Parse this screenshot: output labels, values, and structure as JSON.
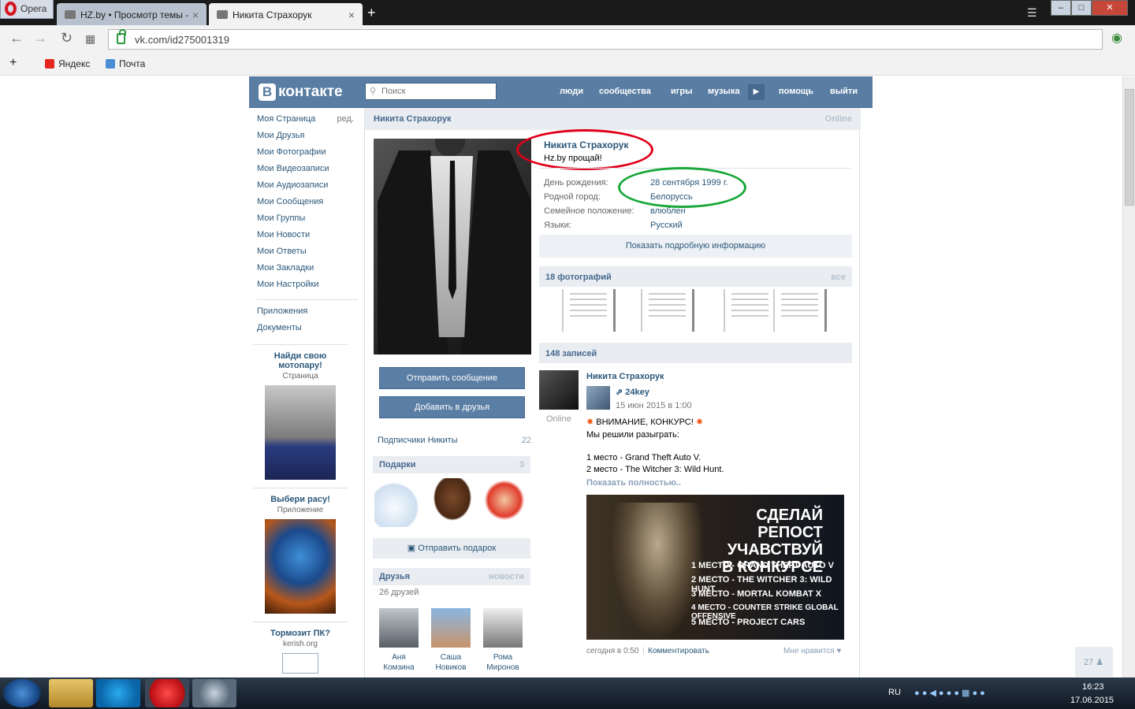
{
  "browser": {
    "opera_label": "Opera",
    "tab1_title": "HZ.by • Просмотр темы -",
    "tab2_title": "Никита Страхорук",
    "url": "vk.com/id275001319",
    "bookmarks": [
      "Яндекс",
      "Почта"
    ]
  },
  "vk": {
    "logo": "контакте",
    "logo_letter": "В",
    "search_placeholder": "Поиск",
    "topnav": [
      "люди",
      "сообщества",
      "игры",
      "музыка",
      "помощь",
      "выйти"
    ],
    "left_menu": [
      "Моя Страница",
      "Мои Друзья",
      "Мои Фотографии",
      "Мои Видеозаписи",
      "Мои Аудиозаписи",
      "Мои Сообщения",
      "Мои Группы",
      "Мои Новости",
      "Мои Ответы",
      "Мои Закладки",
      "Мои Настройки"
    ],
    "edit_label": "ред.",
    "extra_menu": [
      "Приложения",
      "Документы"
    ],
    "ads": [
      {
        "title": "Найди свою мотопару!",
        "sub": "Страница"
      },
      {
        "title": "Выбери расу!",
        "sub": "Приложение"
      },
      {
        "title": "Тормозит ПК?",
        "sub": "kerish.org"
      }
    ],
    "header_name": "Никита Страхорук",
    "online_label": "Online",
    "profile_name": "Никита Страхорук",
    "status": "Hz.by прощай!",
    "info": [
      {
        "label": "День рождения:",
        "value": "28 сентября 1999 г."
      },
      {
        "label": "Родной город:",
        "value": "Белоруссь"
      },
      {
        "label": "Семейное положение:",
        "value": "влюблен"
      },
      {
        "label": "Языки:",
        "value": "Русский"
      }
    ],
    "full_info": "Показать подробную информацию",
    "photos_title": "18 фотографий",
    "photos_all": "все",
    "posts_title": "148 записей",
    "send_message": "Отправить сообщение",
    "add_friend": "Добавить в друзья",
    "subscribers": "Подписчики Никиты",
    "subscribers_count": "22",
    "gifts_title": "Подарки",
    "gifts_count": "3",
    "send_gift": "Отправить подарок",
    "friends_title": "Друзья",
    "friends_news": "новости",
    "friends_count": "26 друзей",
    "friends": [
      {
        "first": "Аня",
        "last": "Комзина"
      },
      {
        "first": "Саша",
        "last": "Новиков"
      },
      {
        "first": "Рома",
        "last": "Миронов"
      }
    ],
    "post": {
      "author": "Никита Страхорук",
      "author_online": "Online",
      "repost_from": "24key",
      "repost_date": "15 июн 2015 в 1:00",
      "line1": "ВНИМАНИЕ, КОНКУРС!",
      "line2": "Мы решили разыграть:",
      "line3": "1 место - Grand Theft Auto V.",
      "line4": "2 место - The Witcher 3: Wild Hunt.",
      "show_more": "Показать полностью..",
      "banner_title": "СДЕЛАЙ РЕПОСТ УЧАВСТВУЙ В КОНКУРСЕ",
      "banner_lines": [
        "1 МЕСТО - GRAND THEFT AUTO V",
        "2 МЕСТО - THE WITCHER 3: WILD HUNT",
        "3 МЕСТО - MORTAL KOMBAT X",
        "4 МЕСТО - COUNTER STRIKE GLOBAL OFFENSIVE",
        "5 МЕСТО - PROJECT CARS"
      ],
      "time": "сегодня в 0:50",
      "comment": "Комментировать",
      "like": "Мне нравится"
    },
    "page_counter": "27"
  },
  "taskbar": {
    "lang": "RU",
    "time": "16:23",
    "date": "17.06.2015"
  },
  "colors": {
    "vk_blue": "#597da3",
    "link": "#2b587a",
    "red_circle": "#e0001a",
    "green_circle": "#1aa83a"
  }
}
